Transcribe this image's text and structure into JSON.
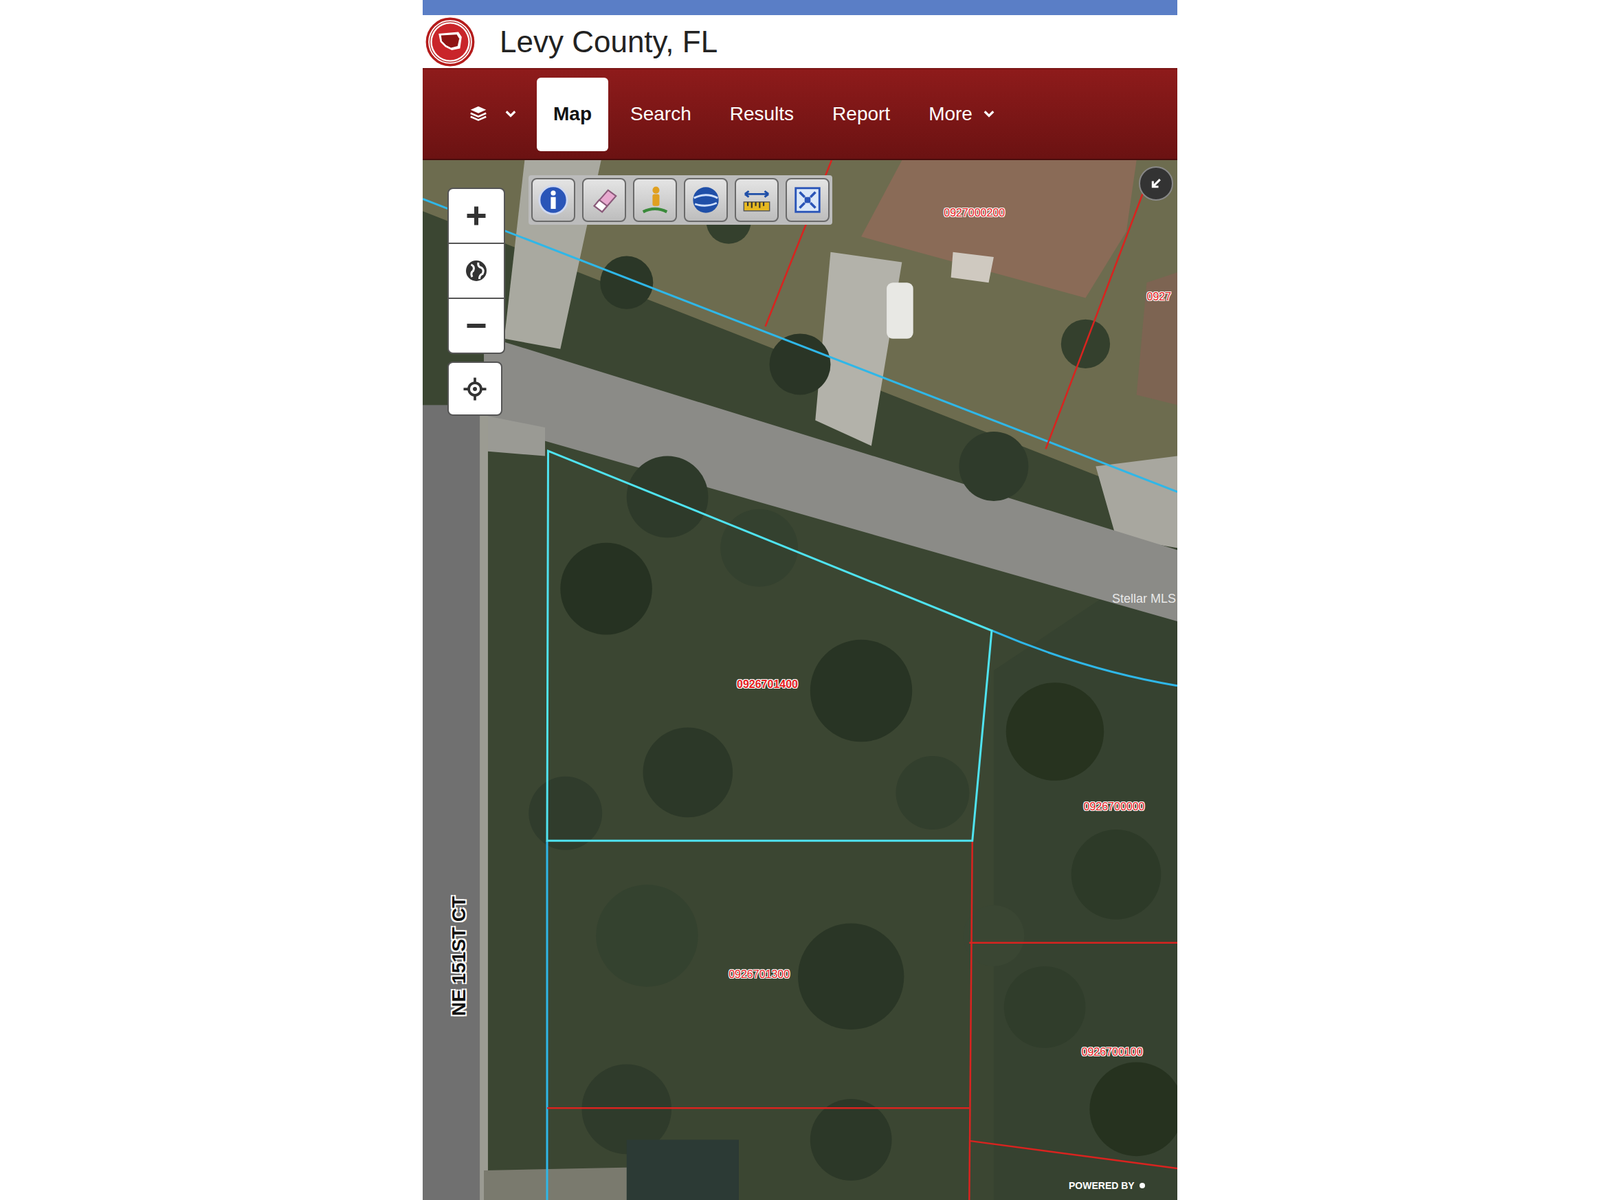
{
  "header": {
    "title": "Levy County, FL"
  },
  "nav": {
    "items": [
      {
        "label": "Map",
        "kind": "tab",
        "selected": true
      },
      {
        "label": "Search",
        "kind": "tab",
        "selected": false
      },
      {
        "label": "Results",
        "kind": "tab",
        "selected": false
      },
      {
        "label": "Report",
        "kind": "tab",
        "selected": false
      },
      {
        "label": "More",
        "kind": "menu",
        "selected": false
      }
    ]
  },
  "map": {
    "parcels": [
      {
        "label": "0927000200",
        "selected": false
      },
      {
        "label": "0927",
        "selected": false
      },
      {
        "label": "0926701400",
        "selected": true
      },
      {
        "label": "0926700000",
        "selected": false
      },
      {
        "label": "0926701300",
        "selected": false
      },
      {
        "label": "0926700100",
        "selected": false
      }
    ],
    "street": "NE 151ST CT",
    "watermark": "Stellar MLS",
    "attribution": "POWERED BY"
  }
}
